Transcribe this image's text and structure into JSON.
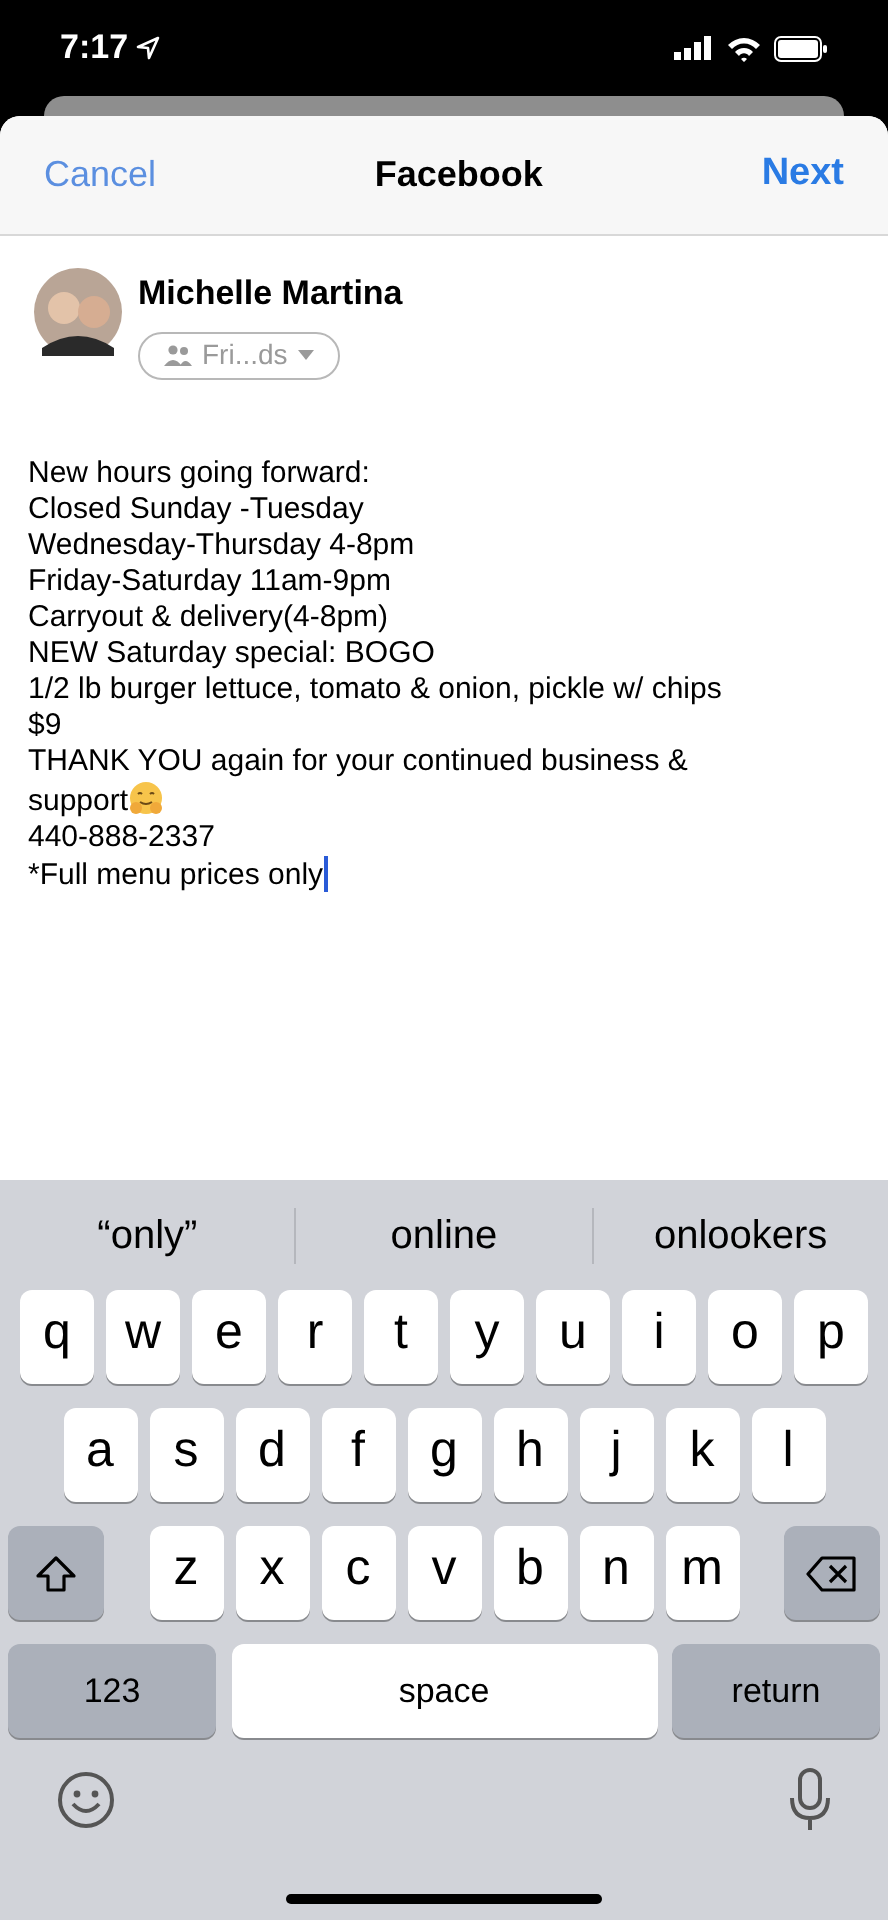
{
  "status_bar": {
    "time": "7:17"
  },
  "header": {
    "cancel": "Cancel",
    "title": "Facebook",
    "next": "Next"
  },
  "author": {
    "name": "Michelle Martina",
    "audience": "Fri...ds"
  },
  "post": {
    "lines": [
      {
        "text": "New hours going forward:"
      },
      {
        "text": "Closed Sunday -Tuesday"
      },
      {
        "text": "Wednesday-Thursday 4-8pm"
      },
      {
        "text": "Friday-Saturday 11am-9pm"
      },
      {
        "text": "Carryout & delivery(4-8pm)"
      },
      {
        "text": "NEW Saturday special: BOGO"
      },
      {
        "text": "1/2 lb burger lettuce, tomato & onion, pickle w/ chips"
      },
      {
        "text": "$9"
      },
      {
        "text": "THANK YOU again for your continued business & support",
        "emoji": true
      },
      {
        "text": "440-888-2337"
      },
      {
        "text": "*Full menu prices only",
        "cursor": true
      }
    ]
  },
  "suggestions": [
    "“only”",
    "online",
    "onlookers"
  ],
  "keyboard": {
    "rows": [
      {
        "keys": [
          {
            "label": "q",
            "kind": "letter"
          },
          {
            "label": "w",
            "kind": "letter"
          },
          {
            "label": "e",
            "kind": "letter"
          },
          {
            "label": "r",
            "kind": "letter"
          },
          {
            "label": "t",
            "kind": "letter"
          },
          {
            "label": "y",
            "kind": "letter"
          },
          {
            "label": "u",
            "kind": "letter"
          },
          {
            "label": "i",
            "kind": "letter"
          },
          {
            "label": "o",
            "kind": "letter"
          },
          {
            "label": "p",
            "kind": "letter"
          }
        ]
      },
      {
        "keys": [
          {
            "label": "a",
            "kind": "letter"
          },
          {
            "label": "s",
            "kind": "letter"
          },
          {
            "label": "d",
            "kind": "letter"
          },
          {
            "label": "f",
            "kind": "letter"
          },
          {
            "label": "g",
            "kind": "letter"
          },
          {
            "label": "h",
            "kind": "letter"
          },
          {
            "label": "j",
            "kind": "letter"
          },
          {
            "label": "k",
            "kind": "letter"
          },
          {
            "label": "l",
            "kind": "letter"
          }
        ]
      },
      {
        "keys": [
          {
            "kind": "shift"
          },
          {
            "label": "z",
            "kind": "letter"
          },
          {
            "label": "x",
            "kind": "letter"
          },
          {
            "label": "c",
            "kind": "letter"
          },
          {
            "label": "v",
            "kind": "letter"
          },
          {
            "label": "b",
            "kind": "letter"
          },
          {
            "label": "n",
            "kind": "letter"
          },
          {
            "label": "m",
            "kind": "letter"
          },
          {
            "kind": "delete"
          }
        ]
      },
      {
        "keys": [
          {
            "label": "123",
            "kind": "mode"
          },
          {
            "label": "space",
            "kind": "space"
          },
          {
            "label": "return",
            "kind": "mode"
          }
        ]
      }
    ]
  }
}
